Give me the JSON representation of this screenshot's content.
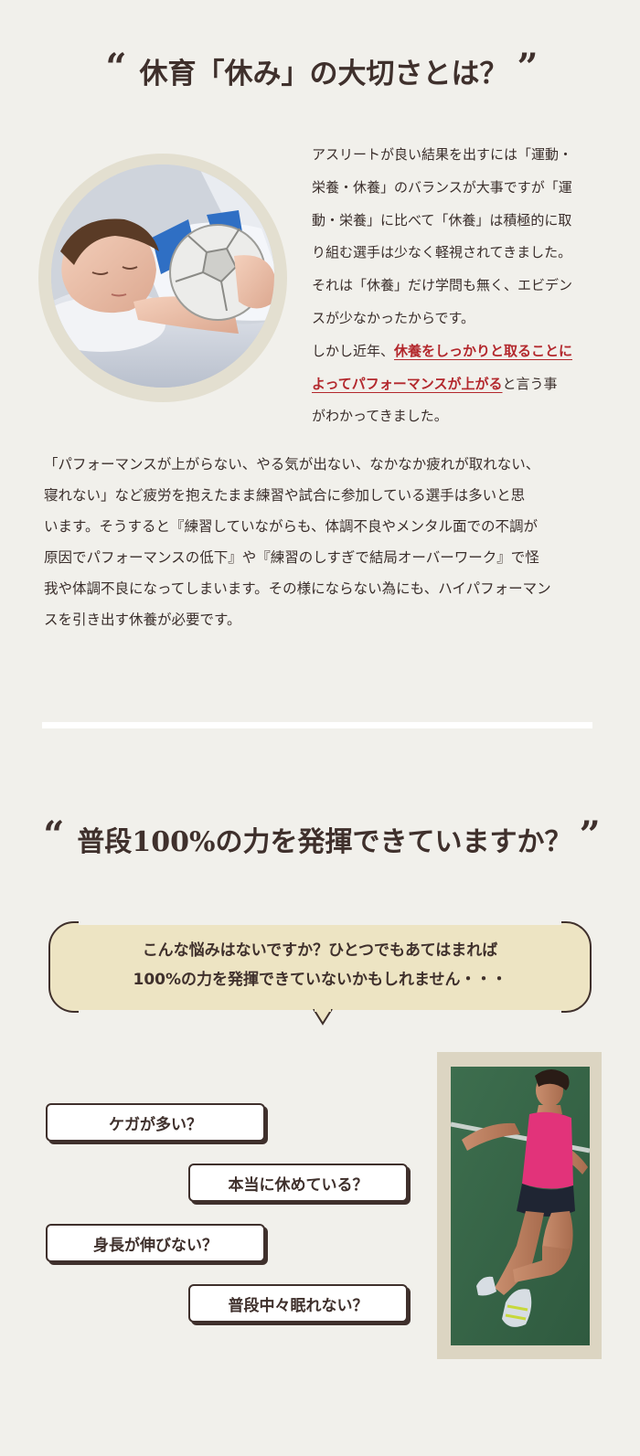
{
  "section1": {
    "heading": {
      "open_quote": "“",
      "title": "休育「休み」の大切さとは？",
      "close_quote": "”"
    },
    "side_paragraph": {
      "lines": [
        "アスリートが良い結果を出すには「運動・",
        "栄養・休養」のバランスが大事ですが「運",
        "動・栄養」に比べて「休養」は積極的に取",
        "り組む選手は少なく軽視されてきました。",
        "それは「休養」だけ学問も無く、エビデン",
        "スが少なかったからです。"
      ],
      "line7_prefix": "しかし近年、",
      "highlight_line7": "休養をしっかりと取ることに",
      "highlight_line8": "よってパフォーマンスが上がる",
      "line8_suffix": "と言う事",
      "line9": "がわかってきました。"
    },
    "body_paragraph": {
      "lines": [
        "「パフォーマンスが上がらない、やる気が出ない、なかなか疲れが取れない、",
        "寝れない」など疲労を抱えたまま練習や試合に参加している選手は多いと思",
        "います。そうすると『練習していながらも、体調不良やメンタル面での不調が",
        "原因でパフォーマンスの低下』や『練習のしすぎで結局オーバーワーク』で怪",
        "我や体調不良になってしまいます。その様にならない為にも、ハイパフォーマン",
        "スを引き出す休養が必要です。"
      ]
    }
  },
  "section2": {
    "heading": {
      "open_quote": "“",
      "title": "普段100%の力を発揮できていますか？",
      "close_quote": "”"
    },
    "bubble": {
      "line1": "こんな悩みはないですか？ひとつでもあてはまれば",
      "line2": "100%の力を発揮できていないかもしれません・・・"
    },
    "checklist": [
      "ケガが多い？",
      "本当に休めている？",
      "身長が伸びない？",
      "普段中々眠れない？"
    ]
  },
  "colors": {
    "background": "#f1f0eb",
    "text": "#3a2e2b",
    "highlight": "#b3282d",
    "bubble": "#ede4c3",
    "frame": "#e3dfd0"
  }
}
